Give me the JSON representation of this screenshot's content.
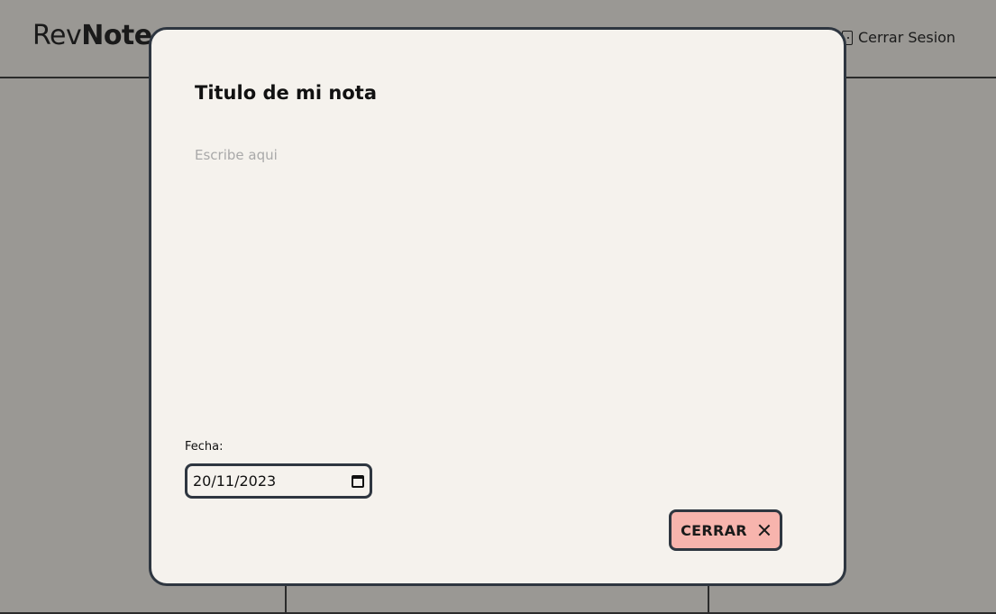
{
  "app": {
    "logo_regular": "Rev",
    "logo_bold": "Note",
    "logout_label": "Cerrar Sesion"
  },
  "modal": {
    "title": "Titulo de mi nota",
    "body_placeholder": "Escribe aqui",
    "date_label": "Fecha:",
    "date_value": "20/11/2023",
    "close_label": "CERRAR"
  },
  "colors": {
    "overlay": "#9a9894",
    "modal_bg": "#f5f2ed",
    "border": "#2e3640",
    "close_button": "#f7b4ad"
  }
}
